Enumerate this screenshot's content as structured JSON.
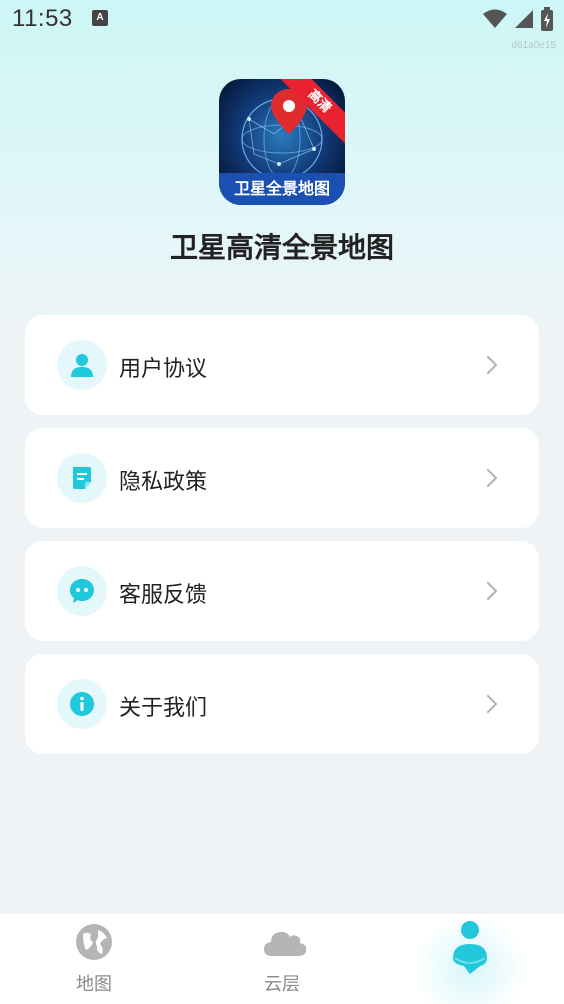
{
  "status_bar": {
    "time": "11:53",
    "notification_icon": "A"
  },
  "build_id": "d61a0e15",
  "app": {
    "logo_ribbon": "高清",
    "logo_caption": "卫星全景地图",
    "title": "卫星高清全景地图"
  },
  "menu": [
    {
      "label": "用户协议",
      "icon": "user-icon"
    },
    {
      "label": "隐私政策",
      "icon": "document-icon"
    },
    {
      "label": "客服反馈",
      "icon": "chat-icon"
    },
    {
      "label": "关于我们",
      "icon": "info-icon"
    }
  ],
  "bottom_nav": [
    {
      "label": "地图",
      "icon": "globe-icon"
    },
    {
      "label": "云层",
      "icon": "cloud-icon"
    },
    {
      "label": "",
      "icon": "profile-icon",
      "active": true
    }
  ],
  "colors": {
    "accent": "#21c8dc",
    "icon_bg": "#e4f7fb",
    "inactive": "#b5b5b5"
  }
}
